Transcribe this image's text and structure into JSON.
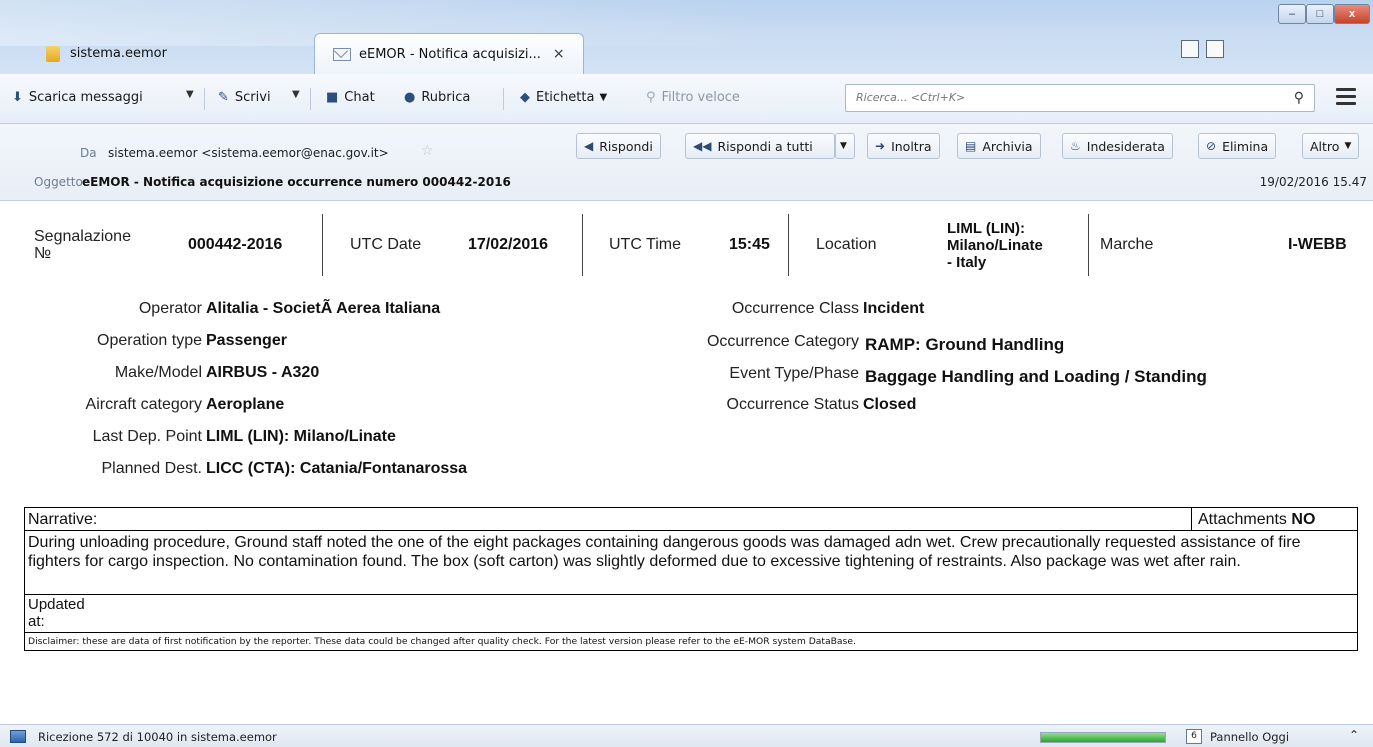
{
  "window": {
    "tabs": [
      {
        "label": "sistema.eemor",
        "icon": "folder-icon",
        "active": false
      },
      {
        "label": "eEMOR - Notifica acquisizi...",
        "icon": "mail-icon",
        "active": true,
        "close": "×"
      }
    ],
    "controls": {
      "minimize": "–",
      "maximize": "□",
      "close": "x"
    }
  },
  "toolbar": {
    "get_messages": "Scarica messaggi",
    "write": "Scrivi",
    "chat": "Chat",
    "address_book": "Rubrica",
    "tag": "Etichetta",
    "quick_filter": "Filtro veloce",
    "search_placeholder": "Ricerca... <Ctrl+K>"
  },
  "header": {
    "from_label": "Da",
    "from_value": "sistema.eemor <sistema.eemor@enac.gov.it>",
    "subject_label": "Oggetto",
    "subject_value": "eEMOR - Notifica acquisizione occurrence numero 000442-2016",
    "date": "19/02/2016 15.47",
    "actions": {
      "reply": "Rispondi",
      "reply_all": "Rispondi a tutti",
      "forward": "Inoltra",
      "archive": "Archivia",
      "junk": "Indesiderata",
      "delete": "Elimina",
      "more": "Altro"
    }
  },
  "report": {
    "summary": {
      "segnalazione_label_1": "Segnalazione",
      "segnalazione_label_2": "№",
      "segnalazione_value": "000442-2016",
      "utc_date_label": "UTC Date",
      "utc_date_value": "17/02/2016",
      "utc_time_label": "UTC Time",
      "utc_time_value": "15:45",
      "location_label": "Location",
      "location_line1": "LIML (LIN):",
      "location_line2": "Milano/Linate",
      "location_line3": "- Italy",
      "marche_label": "Marche",
      "marche_value": "I-WEBB"
    },
    "left_fields": [
      {
        "label": "Operator",
        "value": "Alitalia - SocietÃ  Aerea Italiana"
      },
      {
        "label": "Operation type",
        "value": "Passenger"
      },
      {
        "label": "Make/Model",
        "value": "AIRBUS - A320"
      },
      {
        "label": "Aircraft category",
        "value": "Aeroplane"
      },
      {
        "label": "Last Dep. Point",
        "value": "LIML (LIN): Milano/Linate"
      },
      {
        "label": "Planned Dest.",
        "value": "LICC (CTA): Catania/Fontanarossa"
      }
    ],
    "right_fields": [
      {
        "label": "Occurrence Class",
        "value": "Incident"
      },
      {
        "label": "Occurrence Category",
        "value": "RAMP: Ground Handling"
      },
      {
        "label": "Event Type/Phase",
        "value": "Baggage Handling and Loading / Standing"
      },
      {
        "label": "Occurrence Status",
        "value": "Closed"
      }
    ],
    "narrative": {
      "label": "Narrative:",
      "attachments_label": "Attachments",
      "attachments_value": "NO",
      "text": "During unloading procedure, Ground staff noted the one of the eight packages containing dangerous goods was damaged adn wet. Crew precautionally requested assistance of fire fighters for cargo inspection. No contamination found. The box (soft carton) was slightly deformed due to excessive tightening of restraints. Also package was wet after rain.",
      "updated_1": "Updated",
      "updated_2": "at:",
      "disclaimer": "Disclaimer: these are data of first notification by the reporter. These data could be changed after quality check. For the latest version please refer to the eE-MOR system DataBase."
    }
  },
  "statusbar": {
    "text": "Ricezione 572 di 10040 in sistema.eemor",
    "progress": 1.0,
    "today_count": "6",
    "today_label": "Pannello Oggi"
  }
}
